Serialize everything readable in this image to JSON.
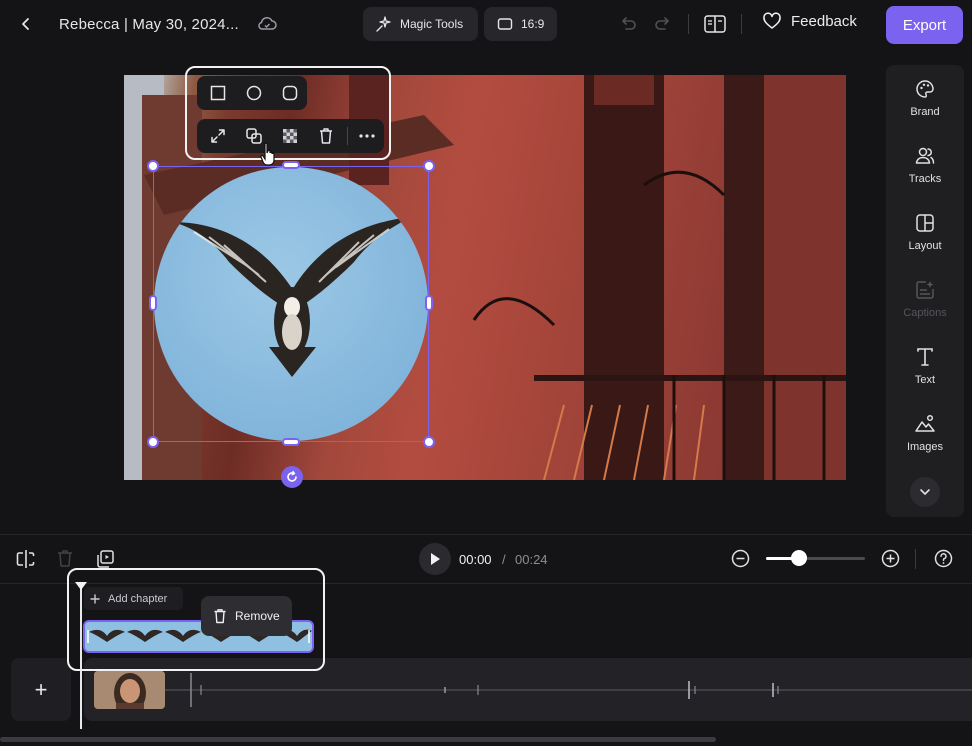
{
  "header": {
    "back_icon": "chevron-left-icon",
    "title": "Rebecca | May 30, 2024...",
    "cloud_icon": "cloud-sync-icon",
    "magic_tools_label": "Magic Tools",
    "aspect_ratio_label": "16:9",
    "feedback_label": "Feedback",
    "export_label": "Export"
  },
  "colors": {
    "accent": "#7b63f0",
    "background": "#141416",
    "panel": "#1f1f22"
  },
  "shape_toolbar": {
    "shapes": [
      "square-icon",
      "circle-icon",
      "rounded-square-icon"
    ],
    "actions": [
      "expand-icon",
      "duplicate-icon",
      "transparency-icon",
      "trash-icon",
      "more-icon"
    ]
  },
  "right_panel": {
    "items": [
      {
        "label": "Brand",
        "icon": "palette-icon"
      },
      {
        "label": "Tracks",
        "icon": "users-icon"
      },
      {
        "label": "Layout",
        "icon": "layout-icon"
      },
      {
        "label": "Captions",
        "icon": "captions-icon",
        "disabled": true
      },
      {
        "label": "Text",
        "icon": "text-icon"
      },
      {
        "label": "Images",
        "icon": "images-icon"
      }
    ],
    "more_icon": "chevron-down-icon"
  },
  "timeline": {
    "current_time": "00:00",
    "separator": "/",
    "total_time": "00:24",
    "zoom_level": 0.33,
    "add_chapter_label": "Add chapter",
    "remove_label": "Remove",
    "add_track_label": "+"
  }
}
